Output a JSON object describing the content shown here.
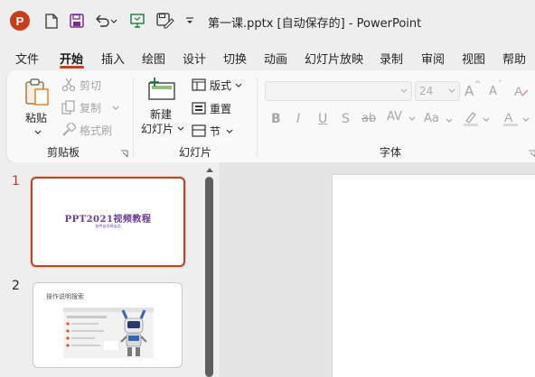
{
  "app": {
    "logo_letter": "P",
    "title": "第一课.pptx [自动保存的]  -  PowerPoint"
  },
  "quick_access": {
    "icons": [
      "new-file-icon",
      "save-icon",
      "undo-icon",
      "present-icon",
      "save-as-icon",
      "customize-icon"
    ]
  },
  "tabs": [
    {
      "label": "文件"
    },
    {
      "label": "开始"
    },
    {
      "label": "插入"
    },
    {
      "label": "绘图"
    },
    {
      "label": "设计"
    },
    {
      "label": "切换"
    },
    {
      "label": "动画"
    },
    {
      "label": "幻灯片放映"
    },
    {
      "label": "录制"
    },
    {
      "label": "审阅"
    },
    {
      "label": "视图"
    },
    {
      "label": "帮助"
    }
  ],
  "active_tab": "开始",
  "ribbon": {
    "clipboard": {
      "paste": "粘贴",
      "cut": "剪切",
      "copy": "复制",
      "format_painter": "格式刷",
      "group": "剪贴板"
    },
    "slides": {
      "new_slide_line1": "新建",
      "new_slide_line2": "幻灯片",
      "layout": "版式",
      "reset": "重置",
      "section": "节",
      "group": "幻灯片"
    },
    "font": {
      "font_name": "",
      "font_size": "24",
      "group": "字体",
      "bold": "B",
      "italic": "I",
      "underline": "U",
      "shadow": "S",
      "strikethrough": "ab",
      "spacing": "AV",
      "case": "Aa",
      "grow": "A",
      "shrink": "A"
    }
  },
  "slides": [
    {
      "number": "1",
      "title": "PPT2021视频教程",
      "subtitle": "软件自学网出品"
    },
    {
      "number": "2",
      "title": "操作说明搜索",
      "subtitle": "你的生活中的好帮手"
    }
  ],
  "colors": {
    "accent": "#c43e1c",
    "title_purple": "#6a3a9a",
    "selected_border": "#b7472a"
  }
}
